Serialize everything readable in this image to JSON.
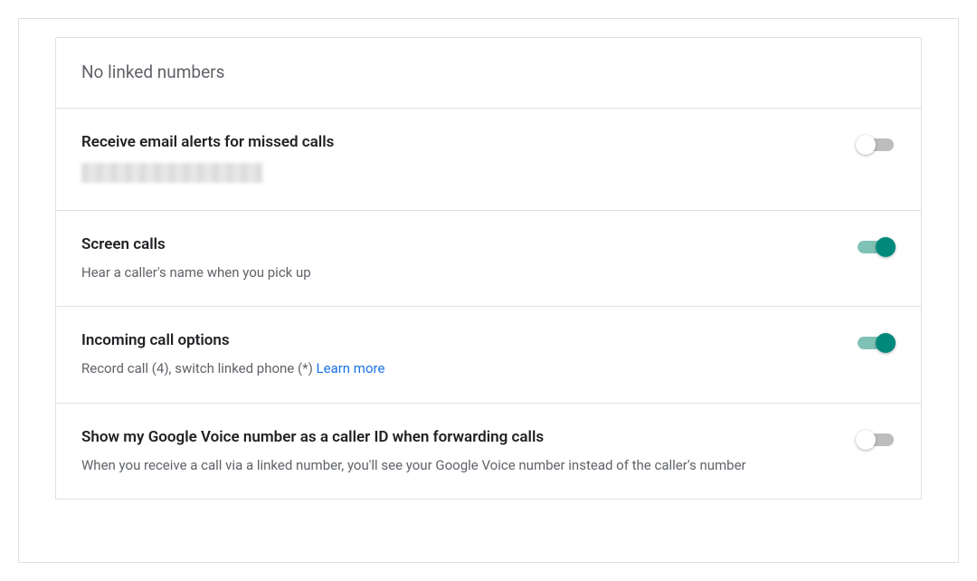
{
  "header": {
    "title": "No linked numbers"
  },
  "settings": [
    {
      "title": "Receive email alerts for missed calls",
      "description_redacted": true,
      "toggle_on": false
    },
    {
      "title": "Screen calls",
      "description": "Hear a caller's name when you pick up",
      "toggle_on": true
    },
    {
      "title": "Incoming call options",
      "description": "Record call (4), switch linked phone (*) ",
      "learn_more": "Learn more",
      "toggle_on": true
    },
    {
      "title": "Show my Google Voice number as a caller ID when forwarding calls",
      "description": "When you receive a call via a linked number, you'll see your Google Voice number instead of the caller's number",
      "toggle_on": false
    }
  ]
}
